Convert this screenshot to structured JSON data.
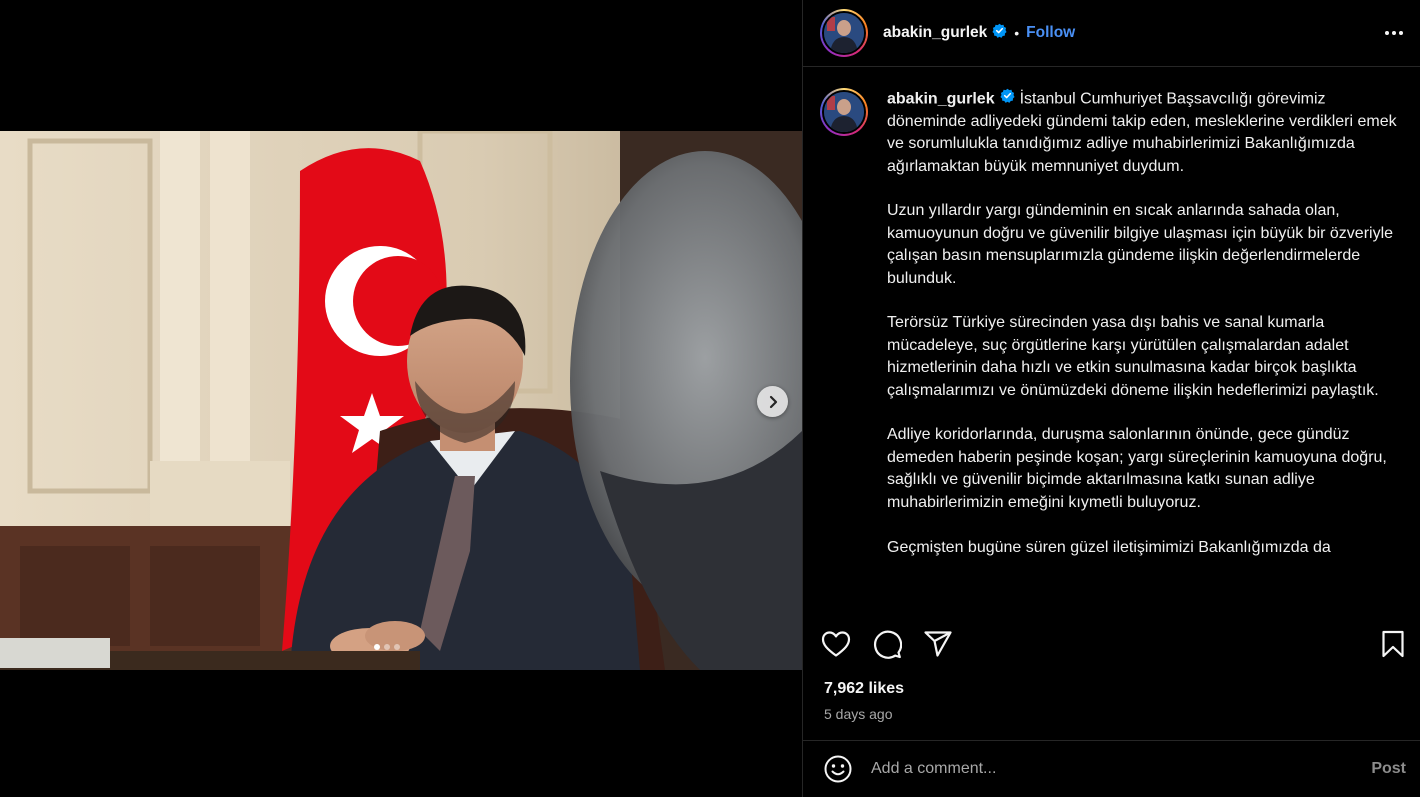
{
  "post": {
    "username": "abakin_gurlek",
    "follow_label": "Follow",
    "separator": "•",
    "caption_paragraphs": [
      "İstanbul Cumhuriyet Başsavcılığı görevimiz döneminde adliyedeki gündemi takip eden, mesleklerine verdikleri emek ve sorumlulukla tanıdığımız adliye muhabirlerimizi Bakanlığımızda ağırlamaktan büyük memnuniyet duydum.",
      "Uzun yıllardır yargı gündeminin en sıcak anlarında sahada olan, kamuoyunun doğru ve güvenilir bilgiye ulaşması için büyük bir özveriyle çalışan basın mensuplarımızla gündeme ilişkin değerlendirmelerde bulunduk.",
      "Terörsüz Türkiye sürecinden yasa dışı bahis ve sanal kumarla mücadeleye, suç örgütlerine karşı yürütülen çalışmalardan adalet hizmetlerinin daha hızlı ve etkin sunulmasına kadar birçok başlıkta çalışmalarımızı ve önümüzdeki döneme ilişkin hedeflerimizi paylaştık.",
      "Adliye koridorlarında, duruşma salonlarının önünde, gece gündüz demeden haberin peşinde koşan; yargı süreçlerinin kamuoyuna doğru, sağlıklı ve güvenilir biçimde aktarılmasına katkı sunan adliye muhabirlerimizin emeğini kıymetli buluyoruz.",
      "Geçmişten bugüne süren güzel iletişimimizi Bakanlığımızda da"
    ],
    "likes": "7,962 likes",
    "time_ago": "5 days ago"
  },
  "carousel": {
    "slide_count": 3,
    "active_index": 0
  },
  "comment": {
    "placeholder": "Add a comment...",
    "post_label": "Post"
  },
  "icons": {
    "verified": "verified-badge-icon",
    "more": "more-options-icon",
    "like": "heart-icon",
    "comment": "comment-icon",
    "share": "share-icon",
    "save": "bookmark-icon",
    "emoji": "emoji-icon",
    "next": "chevron-right-icon"
  },
  "colors": {
    "follow": "#4a90f5",
    "verified": "#0095f6",
    "flag": "#e30a17",
    "muted": "#a8a8a8"
  }
}
